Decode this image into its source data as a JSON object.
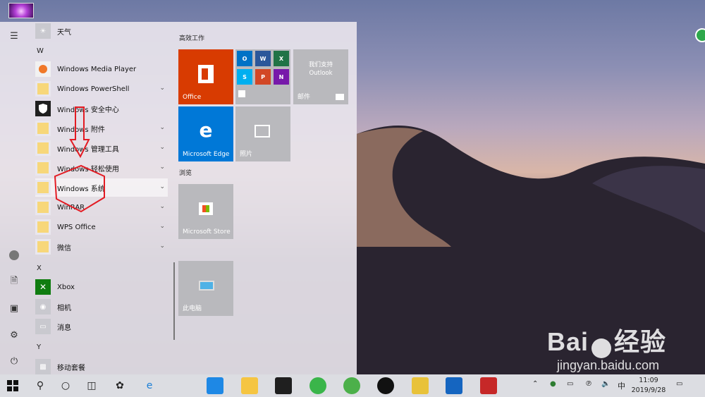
{
  "start_menu": {
    "letters": {
      "w": "W",
      "x": "X",
      "y": "Y"
    },
    "apps": [
      {
        "label": "天气",
        "icon": "weather-icon"
      },
      {
        "label": "Windows Media Player",
        "icon": "media-player-icon"
      },
      {
        "label": "Windows PowerShell",
        "icon": "folder-icon",
        "expandable": true
      },
      {
        "label": "Windows 安全中心",
        "icon": "shield-icon"
      },
      {
        "label": "Windows 附件",
        "icon": "folder-icon",
        "expandable": true
      },
      {
        "label": "Windows 管理工具",
        "icon": "folder-icon",
        "expandable": true
      },
      {
        "label": "Windows 轻松使用",
        "icon": "folder-icon",
        "expandable": true
      },
      {
        "label": "Windows 系统",
        "icon": "folder-icon",
        "expandable": true,
        "selected": true
      },
      {
        "label": "WinRAR",
        "icon": "folder-icon",
        "expandable": true
      },
      {
        "label": "WPS Office",
        "icon": "folder-icon",
        "expandable": true
      },
      {
        "label": "微信",
        "icon": "folder-icon",
        "expandable": true
      },
      {
        "label": "Xbox",
        "icon": "xbox-icon"
      },
      {
        "label": "相机",
        "icon": "camera-icon"
      },
      {
        "label": "消息",
        "icon": "message-icon"
      },
      {
        "label": "移动套餐",
        "icon": "mobile-plan-icon"
      }
    ],
    "groups": {
      "create": "高效工作",
      "browse": "浏览"
    },
    "tiles": {
      "office": "Office",
      "mail_line1": "我们支持",
      "mail_line2": "Outlook",
      "mail": "邮件",
      "edge": "Microsoft Edge",
      "photos": "照片",
      "store": "Microsoft Store",
      "this_pc": "此电脑"
    }
  },
  "watermark": {
    "brand": "Bai",
    "brand_cn": "经验",
    "url": "jingyan.baidu.com"
  },
  "taskbar": {
    "ime": "中",
    "time": "11:09",
    "date": "2019/9/28"
  },
  "colors": {
    "accent": "#0078d7",
    "office": "#d83b01",
    "annotation": "#e31b23"
  }
}
